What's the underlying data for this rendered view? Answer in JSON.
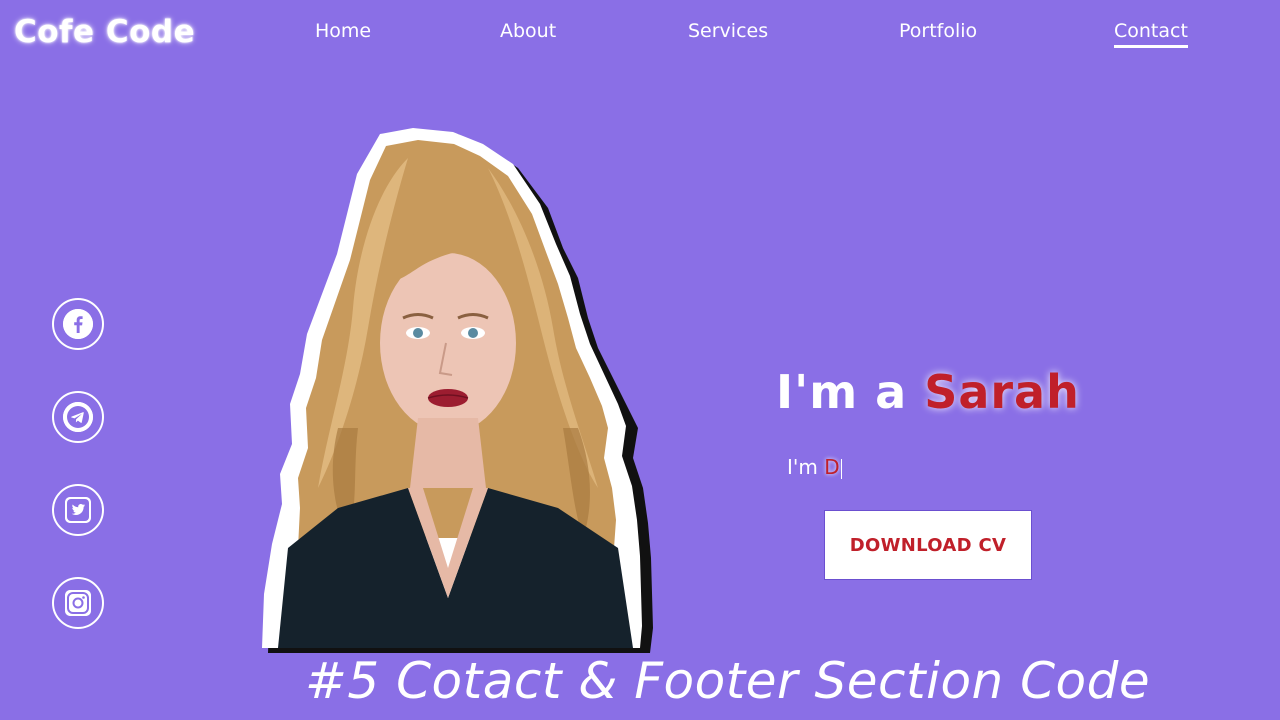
{
  "header": {
    "logo": "Cofe Code",
    "nav": [
      {
        "label": "Home",
        "active": false
      },
      {
        "label": "About",
        "active": false
      },
      {
        "label": "Services",
        "active": false
      },
      {
        "label": "Portfolio",
        "active": false
      },
      {
        "label": "Contact",
        "active": true
      }
    ]
  },
  "social": [
    {
      "icon": "facebook-icon"
    },
    {
      "icon": "telegram-icon"
    },
    {
      "icon": "twitter-icon"
    },
    {
      "icon": "instagram-icon"
    }
  ],
  "hero": {
    "title_prefix": "I'm a",
    "title_name": "Sarah",
    "subtitle_prefix": "I'm",
    "subtitle_typed": "D",
    "cv_button": "DOWNLOAD CV"
  },
  "overlay": {
    "caption": "#5 Cotact & Footer Section Code"
  },
  "colors": {
    "background": "#8a6fe6",
    "accent": "#c0202a",
    "white": "#ffffff"
  }
}
